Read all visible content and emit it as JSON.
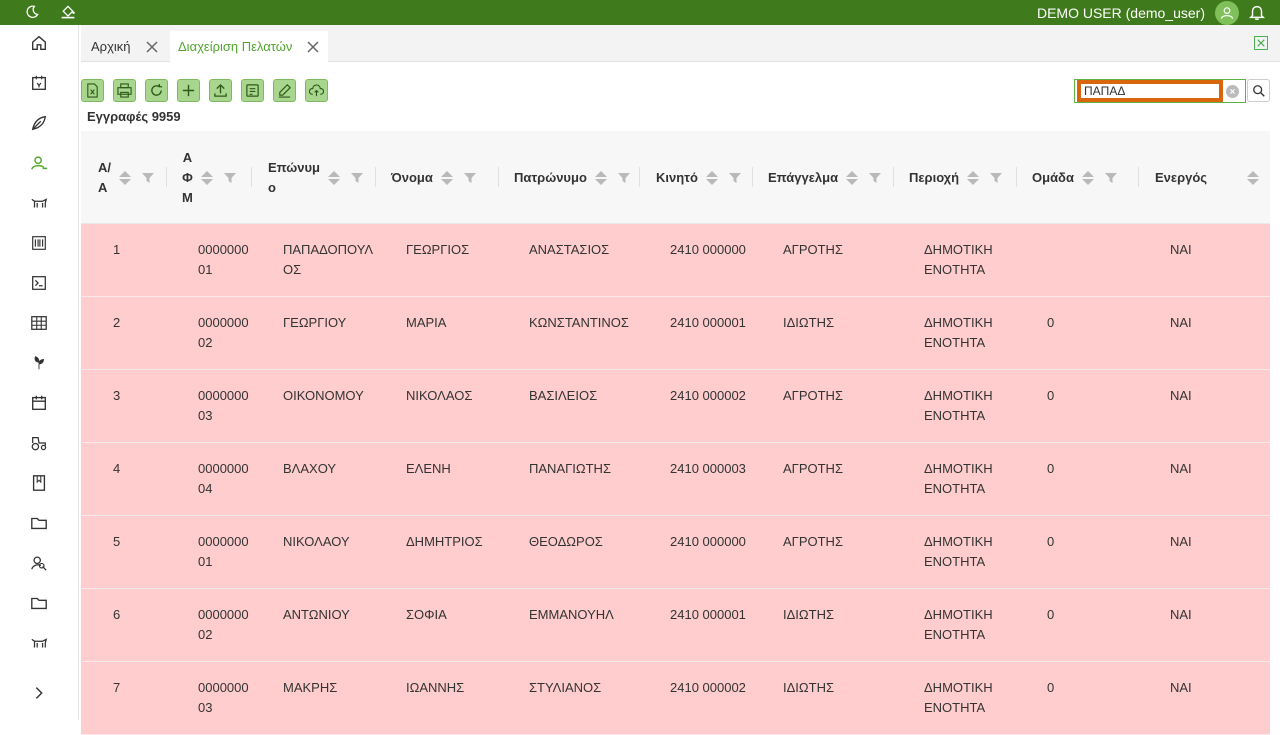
{
  "header": {
    "user_label": "DEMO USER (demo_user)",
    "icons": [
      "moon-icon",
      "paint-bucket-icon",
      "avatar-icon",
      "bell-icon"
    ]
  },
  "sidebar": {
    "items": [
      "home-icon",
      "invoice-icon",
      "leaf-icon",
      "customer-icon",
      "cow-icon",
      "barcode-icon",
      "terminal-icon",
      "grid-table-icon",
      "seedling-icon",
      "calendar-icon",
      "tractor-icon",
      "book-icon",
      "folder-icon",
      "user-search-icon",
      "folder-icon",
      "cow-icon",
      "chevron-right-icon"
    ]
  },
  "tabs": [
    {
      "label": "Αρχική",
      "active": false
    },
    {
      "label": "Διαχείριση Πελατών",
      "active": true
    }
  ],
  "toolbar": {
    "buttons": [
      "excel-export-icon",
      "print-icon",
      "refresh-icon",
      "add-icon",
      "upload-icon",
      "copy-icon",
      "edit-icon",
      "cloud-upload-icon"
    ],
    "records_label": "Εγγραφές 9959"
  },
  "search": {
    "value": "ΠΑΠΑΔ"
  },
  "table": {
    "columns": [
      "Α/Α",
      "ΑΦΜ",
      "Επώνυμο",
      "Όνομα",
      "Πατρώνυμο",
      "Κινητό",
      "Επάγγελμα",
      "Περιοχή",
      "Ομάδα",
      "Ενεργός"
    ],
    "header_lines": {
      "aa": [
        "Α/",
        "Α"
      ],
      "afm": [
        "Α",
        "Φ",
        "Μ"
      ],
      "eponymo": [
        "Επώνυμ",
        "ο"
      ]
    },
    "rows": [
      {
        "aa": "1",
        "afm": [
          "0000000",
          "01"
        ],
        "eponymo": [
          "ΠΑΠΑΔΟΠΟΥΛ",
          "ΟΣ"
        ],
        "onoma": "ΓΕΩΡΓΙΟΣ",
        "patronymo": "ΑΝΑΣΤΑΣΙΟΣ",
        "kinito": "2410 000000",
        "epaggelma": "ΑΓΡΟΤΗΣ",
        "perioxi": [
          "ΔΗΜΟΤΙΚΗ",
          "ΕΝΟΤΗΤΑ"
        ],
        "omada": "",
        "energos": "ΝΑΙ"
      },
      {
        "aa": "2",
        "afm": [
          "0000000",
          "02"
        ],
        "eponymo": [
          "ΓΕΩΡΓΙΟΥ",
          ""
        ],
        "onoma": "ΜΑΡΙΑ",
        "patronymo": "ΚΩΝΣΤΑΝΤΙΝΟΣ",
        "kinito": "2410 000001",
        "epaggelma": "ΙΔΙΩΤΗΣ",
        "perioxi": [
          "ΔΗΜΟΤΙΚΗ",
          "ΕΝΟΤΗΤΑ"
        ],
        "omada": "0",
        "energos": "ΝΑΙ"
      },
      {
        "aa": "3",
        "afm": [
          "0000000",
          "03"
        ],
        "eponymo": [
          "ΟΙΚΟΝΟΜΟΥ",
          ""
        ],
        "onoma": "ΝΙΚΟΛΑΟΣ",
        "patronymo": "ΒΑΣΙΛΕΙΟΣ",
        "kinito": "2410 000002",
        "epaggelma": "ΑΓΡΟΤΗΣ",
        "perioxi": [
          "ΔΗΜΟΤΙΚΗ",
          "ΕΝΟΤΗΤΑ"
        ],
        "omada": "0",
        "energos": "ΝΑΙ"
      },
      {
        "aa": "4",
        "afm": [
          "0000000",
          "04"
        ],
        "eponymo": [
          "ΒΛΑΧΟΥ",
          ""
        ],
        "onoma": "ΕΛΕΝΗ",
        "patronymo": "ΠΑΝΑΓΙΩΤΗΣ",
        "kinito": "2410 000003",
        "epaggelma": "ΑΓΡΟΤΗΣ",
        "perioxi": [
          "ΔΗΜΟΤΙΚΗ",
          "ΕΝΟΤΗΤΑ"
        ],
        "omada": "0",
        "energos": "ΝΑΙ"
      },
      {
        "aa": "5",
        "afm": [
          "0000000",
          "01"
        ],
        "eponymo": [
          "ΝΙΚΟΛΑΟΥ",
          ""
        ],
        "onoma": "ΔΗΜΗΤΡΙΟΣ",
        "patronymo": "ΘΕΟΔΩΡΟΣ",
        "kinito": "2410 000000",
        "epaggelma": "ΑΓΡΟΤΗΣ",
        "perioxi": [
          "ΔΗΜΟΤΙΚΗ",
          "ΕΝΟΤΗΤΑ"
        ],
        "omada": "0",
        "energos": "ΝΑΙ"
      },
      {
        "aa": "6",
        "afm": [
          "0000000",
          "02"
        ],
        "eponymo": [
          "ΑΝΤΩΝΙΟΥ",
          ""
        ],
        "onoma": "ΣΟΦΙΑ",
        "patronymo": "ΕΜΜΑΝΟΥΗΛ",
        "kinito": "2410 000001",
        "epaggelma": "ΙΔΙΩΤΗΣ",
        "perioxi": [
          "ΔΗΜΟΤΙΚΗ",
          "ΕΝΟΤΗΤΑ"
        ],
        "omada": "0",
        "energos": "ΝΑΙ"
      },
      {
        "aa": "7",
        "afm": [
          "0000000",
          "03"
        ],
        "eponymo": [
          "ΜΑΚΡΗΣ",
          ""
        ],
        "onoma": "ΙΩΑΝΝΗΣ",
        "patronymo": "ΣΤΥΛΙΑΝΟΣ",
        "kinito": "2410 000002",
        "epaggelma": "ΙΔΙΩΤΗΣ",
        "perioxi": [
          "ΔΗΜΟΤΙΚΗ",
          "ΕΝΟΤΗΤΑ"
        ],
        "omada": "0",
        "energos": "ΝΑΙ"
      }
    ]
  },
  "colors": {
    "topbar": "#3f7a1c",
    "accent": "#52a52f",
    "row_highlight": "#ffcdcd",
    "search_focus": "#d9650c"
  }
}
